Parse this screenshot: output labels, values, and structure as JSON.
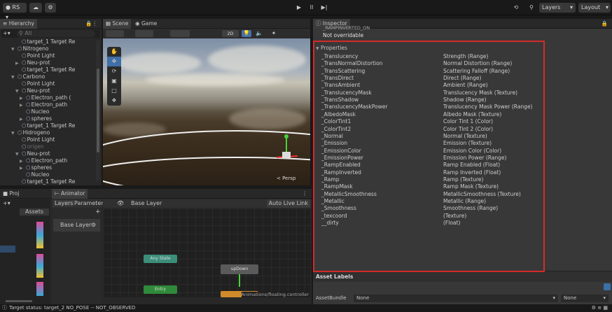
{
  "toolbar": {
    "account_label": "RS",
    "cloud_icon": "cloud-icon",
    "play_icon": "▶",
    "pause_icon": "II",
    "step_icon": "▶|",
    "layers_label": "Layers",
    "layout_label": "Layout"
  },
  "hierarchy": {
    "tab_label": "Hierarchy",
    "search_placeholder": "All",
    "rows": [
      {
        "label": "target_1 Target Re",
        "indent": 3,
        "dim": false,
        "tri": ""
      },
      {
        "label": "Nitrogeno",
        "indent": 2,
        "dim": false,
        "tri": "▼"
      },
      {
        "label": "Point Light",
        "indent": 3,
        "dim": false,
        "tri": ""
      },
      {
        "label": "Neu-prot",
        "indent": 3,
        "dim": false,
        "tri": "▶"
      },
      {
        "label": "target_1 Target Re",
        "indent": 3,
        "dim": false,
        "tri": ""
      },
      {
        "label": "Carbono",
        "indent": 2,
        "dim": false,
        "tri": "▼"
      },
      {
        "label": "Point Light",
        "indent": 3,
        "dim": false,
        "tri": ""
      },
      {
        "label": "Neu-prot",
        "indent": 3,
        "dim": false,
        "tri": "▼"
      },
      {
        "label": "Electron_path (",
        "indent": 4,
        "dim": false,
        "tri": "▶"
      },
      {
        "label": "Electron_path",
        "indent": 4,
        "dim": false,
        "tri": "▶"
      },
      {
        "label": "Nucleo",
        "indent": 4,
        "dim": false,
        "tri": ""
      },
      {
        "label": "spheres",
        "indent": 4,
        "dim": false,
        "tri": "▶"
      },
      {
        "label": "target_1 Target Re",
        "indent": 3,
        "dim": false,
        "tri": ""
      },
      {
        "label": "Hidrogeno",
        "indent": 2,
        "dim": false,
        "tri": "▼"
      },
      {
        "label": "Point Light",
        "indent": 3,
        "dim": false,
        "tri": ""
      },
      {
        "label": "origen",
        "indent": 3,
        "dim": true,
        "tri": ""
      },
      {
        "label": "Neu-prot",
        "indent": 3,
        "dim": false,
        "tri": "▼"
      },
      {
        "label": "Electron_path",
        "indent": 4,
        "dim": false,
        "tri": "▶"
      },
      {
        "label": "spheres",
        "indent": 4,
        "dim": false,
        "tri": "▶"
      },
      {
        "label": "Nucleo",
        "indent": 4,
        "dim": false,
        "tri": ""
      },
      {
        "label": "target_1 Target Re",
        "indent": 3,
        "dim": false,
        "tri": ""
      }
    ]
  },
  "scene": {
    "tab_scene": "Scene",
    "tab_game": "Game",
    "mode_2d": "2D",
    "persp_label": "< Persp"
  },
  "animator": {
    "project_tab": "Proj",
    "animator_tab": "Animator",
    "layers_tab": "Layers",
    "parameters_tab": "Parameters",
    "breadcrumb": "Base Layer",
    "auto_live_link": "Auto Live Link",
    "base_layer_item": "Base Layer",
    "assets_label": "Assets",
    "states": [
      {
        "label": "Any State",
        "color": "#3b8e7a"
      },
      {
        "label": "upDown",
        "color": "#5a5a5a"
      },
      {
        "label": "Entry",
        "color": "#2f8a3a"
      },
      {
        "label": "",
        "color": "#d08a2a"
      }
    ],
    "footer_path": "Animations/floating.controller"
  },
  "inspector": {
    "tab_label": "Inspector",
    "partial_top_text": "_RAMPINVERTED_ON",
    "not_overridable": "Not overridable",
    "properties_header": "Properties",
    "properties": [
      {
        "name": "_Translucency",
        "type": "Strength (Range)"
      },
      {
        "name": "_TransNormalDistortion",
        "type": "Normal Distortion (Range)"
      },
      {
        "name": "_TransScattering",
        "type": "Scattering Falloff (Range)"
      },
      {
        "name": "_TransDirect",
        "type": "Direct (Range)"
      },
      {
        "name": "_TransAmbient",
        "type": "Ambient (Range)"
      },
      {
        "name": "_TranslucencyMask",
        "type": "Translucency Mask (Texture)"
      },
      {
        "name": "_TransShadow",
        "type": "Shadow (Range)"
      },
      {
        "name": "_TranslucencyMaskPower",
        "type": "Translucency Mask Power (Range)"
      },
      {
        "name": "_AlbedoMask",
        "type": "Albedo Mask (Texture)"
      },
      {
        "name": "_ColorTint1",
        "type": "Color Tint 1 (Color)"
      },
      {
        "name": "_ColorTint2",
        "type": "Color Tint 2 (Color)"
      },
      {
        "name": "_Normal",
        "type": "Normal (Texture)"
      },
      {
        "name": "_Emission",
        "type": "Emission (Texture)"
      },
      {
        "name": "_EmissionColor",
        "type": "Emission Color (Color)"
      },
      {
        "name": "_EmissionPower",
        "type": "Emission Power (Range)"
      },
      {
        "name": "_RampEnabled",
        "type": "Ramp Enabled (Float)"
      },
      {
        "name": "_RampInverted",
        "type": "Ramp Inverted (Float)"
      },
      {
        "name": "_Ramp",
        "type": "Ramp (Texture)"
      },
      {
        "name": "_RampMask",
        "type": "Ramp Mask (Texture)"
      },
      {
        "name": "_MetallicSmoothness",
        "type": "MetallicSmoothness (Texture)"
      },
      {
        "name": "_Metallic",
        "type": "Metallic (Range)"
      },
      {
        "name": "_Smoothness",
        "type": "Smoothness (Range)"
      },
      {
        "name": "_texcoord",
        "type": "(Texture)"
      },
      {
        "name": "__dirty",
        "type": "(Float)"
      }
    ],
    "asset_labels": "Asset Labels",
    "asset_bundle_label": "AssetBundle",
    "asset_bundle_value": "None",
    "asset_bundle_variant": "None",
    "highlight_color": "#d62a2a"
  },
  "status": {
    "text": "Target status: target_2 NO_POSE -- NOT_OBSERVED"
  }
}
